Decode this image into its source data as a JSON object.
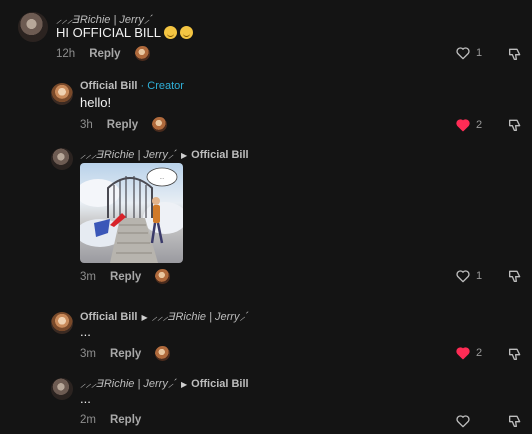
{
  "comments": [
    {
      "author": "⸝⸝⸝ƎRichie | Jerry⸝´",
      "text": "HI OFFICIAL BILL",
      "time": "12h",
      "reply_label": "Reply",
      "likes": "1",
      "liked": false
    },
    {
      "author": "Official Bill",
      "badge": "· Creator",
      "text": "hello!",
      "time": "3h",
      "reply_label": "Reply",
      "likes": "2",
      "liked": true
    },
    {
      "author": "⸝⸝⸝ƎRichie | Jerry⸝´",
      "reply_to": "Official Bill",
      "has_image": true,
      "image_speech": "...",
      "time": "3m",
      "reply_label": "Reply",
      "likes": "1",
      "liked": false
    },
    {
      "author": "Official Bill",
      "reply_to": "⸝⸝⸝ƎRichie | Jerry⸝´",
      "text": "...",
      "time": "3m",
      "reply_label": "Reply",
      "likes": "2",
      "liked": true
    },
    {
      "author": "⸝⸝⸝ƎRichie | Jerry⸝´",
      "reply_to": "Official Bill",
      "text": "...",
      "time": "2m",
      "reply_label": "Reply",
      "likes": "",
      "liked": false
    }
  ],
  "colors": {
    "background": "#141414",
    "creator": "#2fb0d8",
    "liked_heart": "#fe2c55"
  },
  "icons": {
    "like": "heart-icon",
    "dislike": "thumbs-down-icon"
  }
}
